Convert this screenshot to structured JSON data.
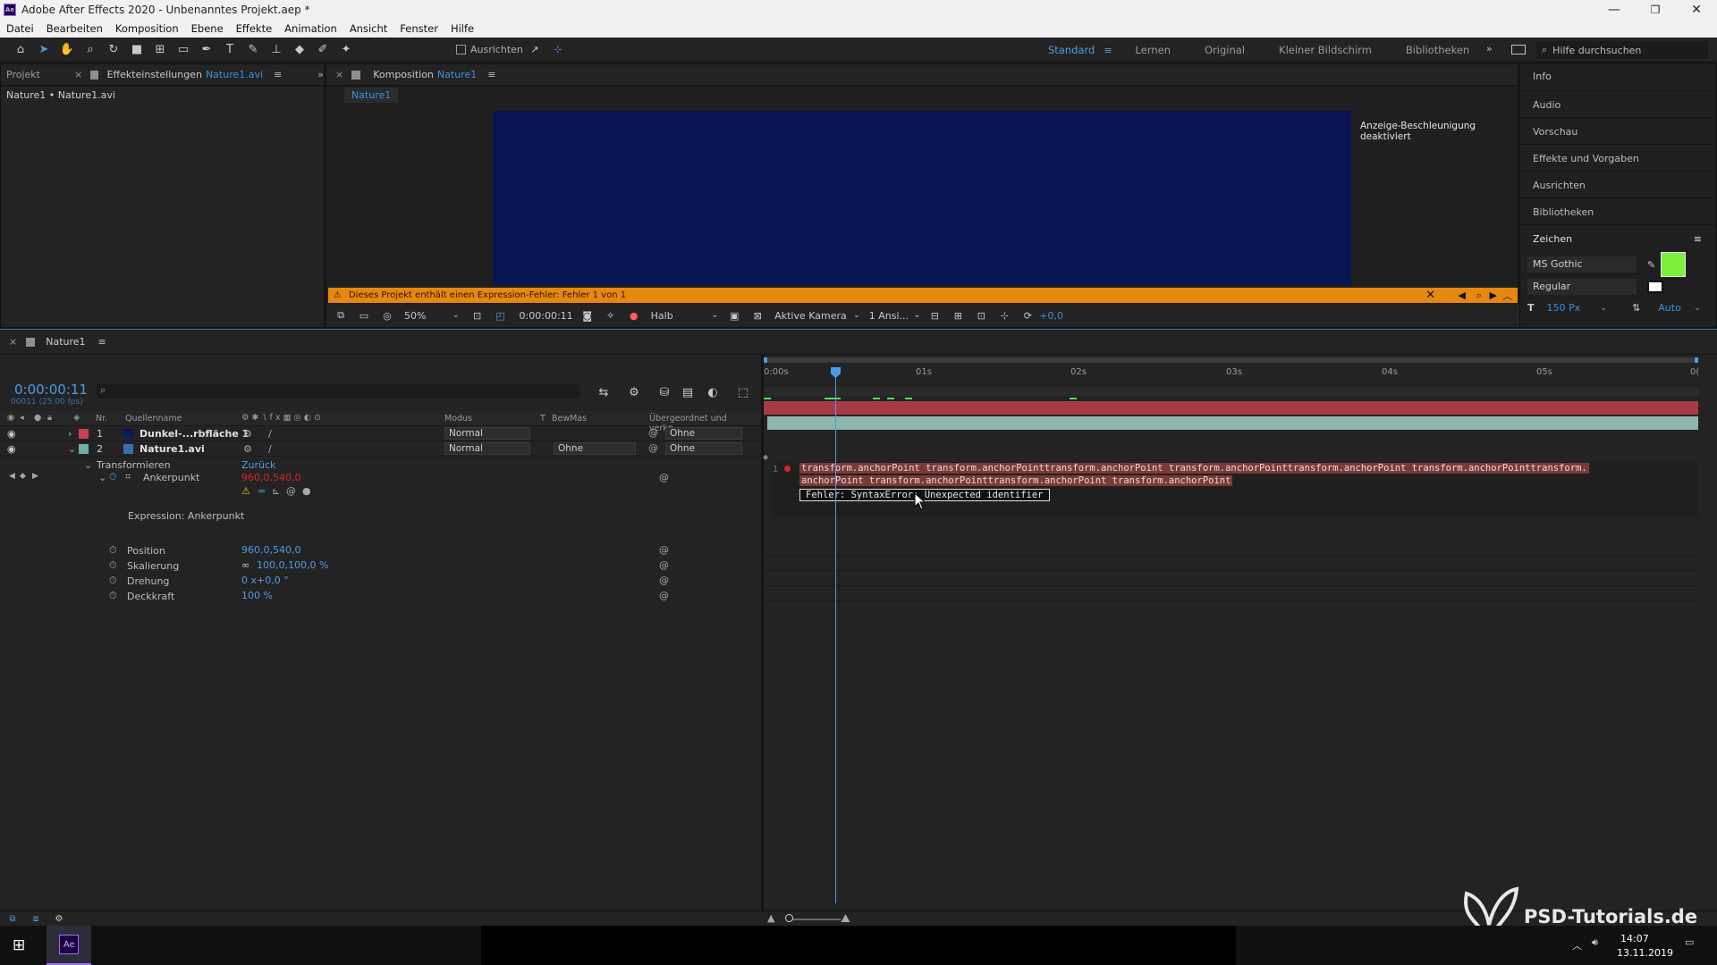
{
  "window": {
    "title": "Adobe After Effects 2020 - Unbenanntes Projekt.aep *"
  },
  "menu": [
    "Datei",
    "Bearbeiten",
    "Komposition",
    "Ebene",
    "Effekte",
    "Animation",
    "Ansicht",
    "Fenster",
    "Hilfe"
  ],
  "toolbar": {
    "snap_label": "Ausrichten",
    "workspaces": [
      "Standard",
      "Lernen",
      "Original",
      "Kleiner Bildschirm",
      "Bibliotheken"
    ],
    "active_workspace": "Standard",
    "search_placeholder": "Hilfe durchsuchen"
  },
  "project_panel": {
    "tab_project": "Projekt",
    "tab_effects": "Effekteinstellungen",
    "tab_effects_target": "Nature1.avi",
    "breadcrumb": "Nature1 • Nature1.avi"
  },
  "comp_panel": {
    "tab_label": "Komposition",
    "tab_target": "Nature1",
    "sub_tab": "Nature1",
    "gpu_notice": "Anzeige-Beschleunigung deaktiviert",
    "error_bar": "Dieses Projekt enthält einen Expression-Fehler: Fehler 1 von 1",
    "zoom": "50%",
    "timecode": "0:00:00:11",
    "resolution": "Halb",
    "camera": "Aktive Kamera",
    "views": "1 Ansi...",
    "exposure": "+0,0",
    "preview_color": "#071552",
    "error_color": "#e8870e"
  },
  "right_panel": {
    "items": [
      "Info",
      "Audio",
      "Vorschau",
      "Effekte und Vorgaben",
      "Ausrichten",
      "Bibliotheken"
    ],
    "character_title": "Zeichen",
    "font": "MS Gothic",
    "style": "Regular",
    "size": "150 Px",
    "leading": "Auto",
    "fill_color": "#7cf03a"
  },
  "timeline": {
    "tab": "Nature1",
    "timecode": "0:00:00:11",
    "frames": "00011 (25.00 fps)",
    "columns": {
      "nr": "Nr.",
      "source": "Quellenname",
      "mode": "Modus",
      "t": "T",
      "trkmat": "BewMas",
      "parent": "Übergeordnet und verkn..."
    },
    "layers": [
      {
        "nr": "1",
        "name": "Dunkel-...rbfläche 1",
        "mode": "Normal",
        "trkmat": "",
        "parent": "Ohne",
        "color": "#c94250"
      },
      {
        "nr": "2",
        "name": "Nature1.avi",
        "mode": "Normal",
        "trkmat": "Ohne",
        "parent": "Ohne",
        "color": "#6fb1a8"
      }
    ],
    "transform_label": "Transformieren",
    "reset_label": "Zurück",
    "anchor_label": "Ankerpunkt",
    "anchor_value": "960,0,540,0",
    "expression_label": "Expression: Ankerpunkt",
    "props": [
      {
        "name": "Position",
        "value": "960,0,540,0"
      },
      {
        "name": "Skalierung",
        "value": "100,0,100,0 %"
      },
      {
        "name": "Drehung",
        "value": "0 x+0,0 °"
      },
      {
        "name": "Deckkraft",
        "value": "100 %"
      }
    ],
    "ruler": [
      "0:00s",
      "01s",
      "02s",
      "03s",
      "04s",
      "05s",
      "0("
    ],
    "expression_line_no": "1",
    "expression_text_1": "transform.anchorPoint transform.anchorPointtransform.anchorPoint transform.anchorPointtransform.anchorPoint transform.anchorPointtransform.",
    "expression_text_2": "anchorPoint transform.anchorPointtransform.anchorPoint transform.anchorPoint",
    "expression_error": "Fehler: SyntaxError: Unexpected identifier"
  },
  "taskbar": {
    "time": "14:07",
    "date": "13.11.2019",
    "app_label": "Ae"
  },
  "watermark": "PSD-Tutorials.de"
}
